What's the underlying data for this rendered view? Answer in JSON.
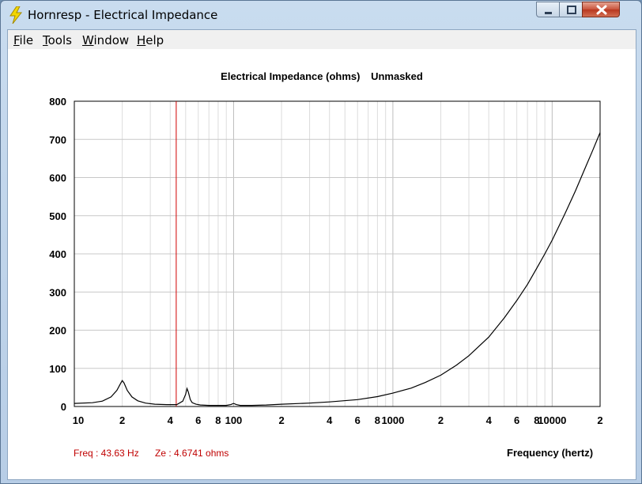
{
  "window": {
    "title": "Hornresp - Electrical Impedance"
  },
  "menu": {
    "items": [
      "File",
      "Tools",
      "Window",
      "Help"
    ]
  },
  "chart_title": {
    "main": "Electrical Impedance (ohms)",
    "mode": "Unmasked"
  },
  "readout": {
    "freq": "Freq : 43.63 Hz",
    "ze": "Ze : 4.6741 ohms"
  },
  "colors": {
    "cursor": "#d00000",
    "curve": "#000000",
    "grid": "#cfcfcf",
    "readout": "#c00000"
  },
  "chart_data": {
    "type": "line",
    "title": "Electrical Impedance (ohms)   Unmasked",
    "xlabel": "Frequency (hertz)",
    "ylabel": "",
    "xscale": "log",
    "xlim": [
      10,
      20000
    ],
    "ylim": [
      0,
      800
    ],
    "grid": true,
    "y_ticks": [
      0,
      100,
      200,
      300,
      400,
      500,
      600,
      700,
      800
    ],
    "x_tick_values": [
      10,
      20,
      40,
      60,
      80,
      100,
      200,
      400,
      600,
      800,
      1000,
      2000,
      4000,
      6000,
      8000,
      10000,
      20000
    ],
    "x_tick_labels": [
      "10",
      "2",
      "4",
      "6",
      "8",
      "100",
      "2",
      "4",
      "6",
      "8",
      "1000",
      "2",
      "4",
      "6",
      "8",
      "10000",
      "2"
    ],
    "cursor_x": 43.63,
    "series": [
      {
        "x": [
          10,
          13,
          15,
          17,
          18.5,
          19.5,
          20,
          20.5,
          21.5,
          23,
          25,
          28,
          32,
          38,
          44,
          48,
          50,
          51,
          52,
          53.5,
          55,
          58,
          62,
          70,
          80,
          90,
          96,
          100,
          104,
          110,
          130,
          160,
          200,
          300,
          400,
          600,
          800,
          1000,
          1300,
          1600,
          2000,
          2500,
          3000,
          4000,
          5000,
          6000,
          7000,
          8000,
          9000,
          10000,
          12000,
          14000,
          16000,
          18000,
          20000
        ],
        "y": [
          8,
          10,
          14,
          25,
          42,
          60,
          68,
          62,
          42,
          25,
          15,
          9,
          6,
          5,
          5,
          14,
          32,
          47,
          38,
          18,
          10,
          6,
          4,
          3,
          3,
          3,
          5,
          8,
          5,
          3,
          3,
          4,
          6,
          9,
          12,
          18,
          26,
          35,
          48,
          63,
          82,
          108,
          133,
          182,
          232,
          278,
          320,
          362,
          400,
          436,
          504,
          565,
          622,
          672,
          718
        ]
      }
    ]
  }
}
